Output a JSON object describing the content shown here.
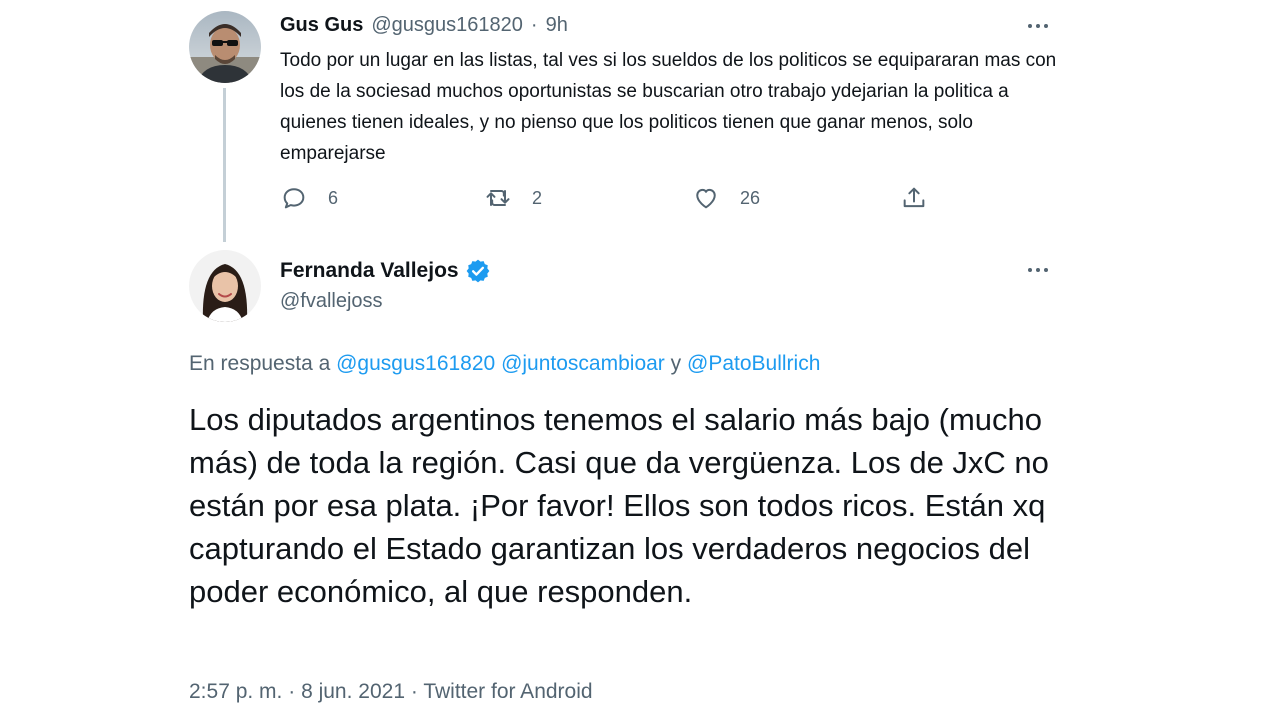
{
  "reply_tweet": {
    "author_name": "Gus Gus",
    "handle": "@gusgus161820",
    "separator": "·",
    "time": "9h",
    "text": "Todo por un lugar en las listas, tal ves si los sueldos de los politicos se equipararan mas con los de la sociesad muchos oportunistas se buscarian otro trabajo ydejarian la politica a quienes tienen ideales, y no pienso que los politicos tienen que ganar menos, solo emparejarse",
    "actions": {
      "reply_count": "6",
      "retweet_count": "2",
      "like_count": "26"
    }
  },
  "main_tweet": {
    "author_name": "Fernanda Vallejos",
    "handle": "@fvallejoss",
    "in_reply_prefix": "En respuesta a",
    "mentions": [
      "@gusgus161820",
      "@juntoscambioar"
    ],
    "conjunction": "y",
    "last_mention": "@PatoBullrich",
    "text": "Los diputados argentinos tenemos el salario más bajo (mucho más) de toda la región. Casi que da vergüenza. Los de JxC no están por esa plata. ¡Por favor! Ellos son todos ricos. Están xq capturando el Estado garantizan los verdaderos negocios del poder económico, al que responden.",
    "time": "2:57 p. m.",
    "separator1": "·",
    "date": "8 jun. 2021",
    "separator2": "·",
    "source": "Twitter for Android"
  },
  "colors": {
    "text": "#0f1419",
    "secondary": "#536471",
    "link": "#1d9bf0",
    "thread_line": "#c4cfd6",
    "verified": "#1d9bf0"
  },
  "icons": {
    "reply": "speech-bubble-icon",
    "retweet": "retweet-icon",
    "like": "heart-icon",
    "share": "share-icon",
    "more": "more-dots-icon",
    "verified": "verified-badge-icon"
  }
}
